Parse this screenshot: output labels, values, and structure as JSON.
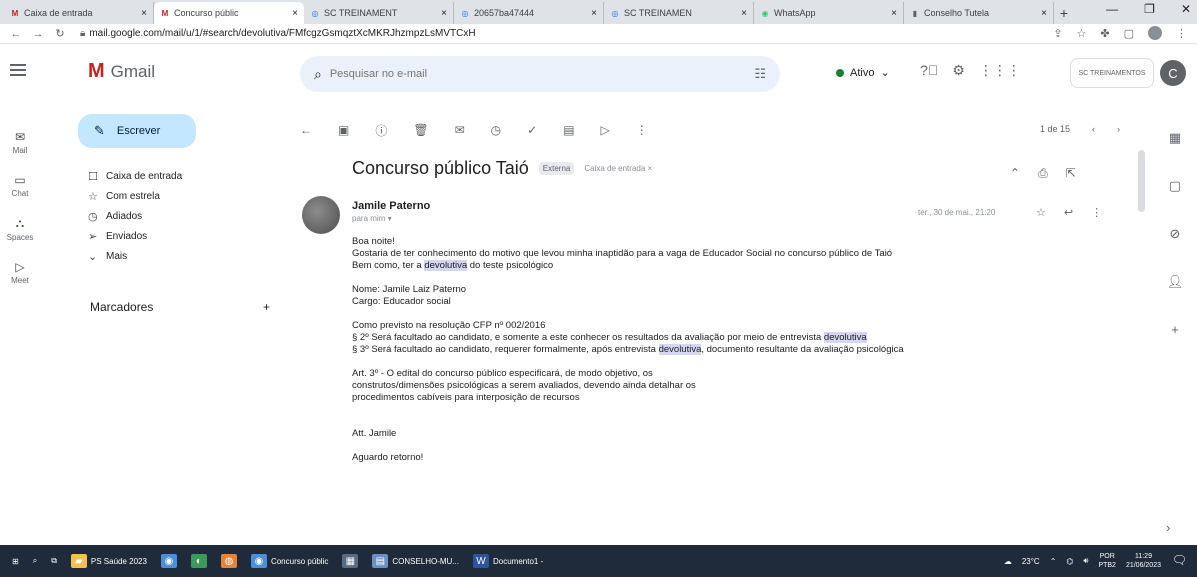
{
  "browser": {
    "tabs": [
      {
        "label": "Caixa de entrada",
        "icon": "gmail-icon",
        "color": "#c5221f"
      },
      {
        "label": "Concurso públic",
        "icon": "gmail-icon",
        "color": "#c5221f",
        "active": true
      },
      {
        "label": "SC TREINAMENT",
        "icon": "globe-icon",
        "color": "#1a73e8"
      },
      {
        "label": "20657ba47444",
        "icon": "globe-icon",
        "color": "#1a73e8"
      },
      {
        "label": "SC TREINAMEN",
        "icon": "globe-icon",
        "color": "#1a73e8"
      },
      {
        "label": "WhatsApp",
        "icon": "whatsapp-icon",
        "color": "#25d366"
      },
      {
        "label": "Conselho Tutela",
        "icon": "page-icon",
        "color": "#5f6368"
      }
    ],
    "new_tab": "+",
    "url": "mail.google.com/mail/u/1/#search/devolutiva/FMfcgzGsmqztXcMKRJhzmpzLsMVTCxH"
  },
  "gmail": {
    "logo_text": "Gmail",
    "search_placeholder": "Pesquisar no e-mail",
    "status": "Ativo",
    "account_label": "SC TREINAMENTOS",
    "avatar_letter": "C"
  },
  "rail": [
    {
      "label": "Mail",
      "icon": "mail-icon"
    },
    {
      "label": "Chat",
      "icon": "chat-icon"
    },
    {
      "label": "Spaces",
      "icon": "spaces-icon"
    },
    {
      "label": "Meet",
      "icon": "meet-icon"
    }
  ],
  "sidebar": {
    "compose": "Escrever",
    "folders": [
      {
        "label": "Caixa de entrada",
        "icon": "inbox-icon",
        "glyph": "☐"
      },
      {
        "label": "Com estrela",
        "icon": "star-icon",
        "glyph": "☆"
      },
      {
        "label": "Adiados",
        "icon": "clock-icon",
        "glyph": "◷"
      },
      {
        "label": "Enviados",
        "icon": "send-icon",
        "glyph": "➢"
      },
      {
        "label": "Mais",
        "icon": "chevron-down-icon",
        "glyph": "⌄"
      }
    ],
    "labels_title": "Marcadores",
    "labels_add": "+"
  },
  "toolbar": {
    "pager": "1 de 15"
  },
  "message": {
    "subject": "Concurso público Taió",
    "badge_external": "Externa",
    "badge_inbox": "Caixa de entrada ×",
    "sender": "Jamile Paterno",
    "to": "para mim ▾",
    "date": "ter., 30 de mai., 21:20",
    "lines": [
      {
        "segments": [
          {
            "t": "Boa noite!"
          }
        ]
      },
      {
        "segments": [
          {
            "t": "Gostaria de ter conhecimento do motivo que levou minha inaptidão para a vaga de Educador Social no concurso público de Taió"
          }
        ]
      },
      {
        "segments": [
          {
            "t": "Bem como, ter a "
          },
          {
            "t": "devolutiva",
            "hl": true
          },
          {
            "t": " do teste psicológico"
          }
        ]
      },
      {
        "segments": [
          {
            "t": ""
          }
        ]
      },
      {
        "segments": [
          {
            "t": "Nome: Jamile Laiz Paterno"
          }
        ]
      },
      {
        "segments": [
          {
            "t": "Cargo: Educador social"
          }
        ]
      },
      {
        "segments": [
          {
            "t": ""
          }
        ]
      },
      {
        "segments": [
          {
            "t": "Como previsto na resolução CFP nº 002/2016"
          }
        ]
      },
      {
        "segments": [
          {
            "t": "§ 2º Será facultado ao candidato, e somente a este conhecer os resultados da avaliação por meio de entrevista "
          },
          {
            "t": "devolutiva",
            "hl": true
          }
        ]
      },
      {
        "segments": [
          {
            "t": "§ 3º Será facultado ao candidato, requerer formalmente, após entrevista "
          },
          {
            "t": "devolutiva",
            "hl": true
          },
          {
            "t": ", documento resultante da avaliação psicológica"
          }
        ]
      },
      {
        "segments": [
          {
            "t": ""
          }
        ]
      },
      {
        "segments": [
          {
            "t": "Art. 3º - O edital do concurso público especificará, de modo objetivo, os"
          }
        ]
      },
      {
        "segments": [
          {
            "t": "construtos/dimensões psicológicas a serem avaliados, devendo ainda detalhar os"
          }
        ]
      },
      {
        "segments": [
          {
            "t": "procedimentos cabíveis para interposição de recursos"
          }
        ]
      },
      {
        "segments": [
          {
            "t": ""
          }
        ]
      },
      {
        "segments": [
          {
            "t": ""
          }
        ]
      },
      {
        "segments": [
          {
            "t": "Att. Jamile"
          }
        ]
      },
      {
        "segments": [
          {
            "t": ""
          }
        ]
      },
      {
        "segments": [
          {
            "t": "Aguardo retorno!"
          }
        ]
      }
    ]
  },
  "taskbar": {
    "items": [
      {
        "label": "PS Saúde 2023",
        "icon": "folder-icon",
        "color": "#f2c14e"
      },
      {
        "label": "",
        "icon": "chrome-icon",
        "color": "#4a90d9"
      },
      {
        "label": "",
        "icon": "edge-icon",
        "color": "#3a9a5a"
      },
      {
        "label": "",
        "icon": "firefox-icon",
        "color": "#e8823a"
      },
      {
        "label": "Concurso públic",
        "icon": "chrome-icon",
        "color": "#4a90d9"
      },
      {
        "label": "",
        "icon": "store-icon",
        "color": "#5a6a80"
      },
      {
        "label": "CONSELHO-MU...",
        "icon": "explorer-icon",
        "color": "#6a8fc0"
      },
      {
        "label": "Documento1 -",
        "icon": "word-icon",
        "color": "#2b579a"
      }
    ],
    "weather": "23°C",
    "lang": "POR",
    "lang2": "PTB2",
    "time": "11:29",
    "date": "21/06/2023"
  }
}
